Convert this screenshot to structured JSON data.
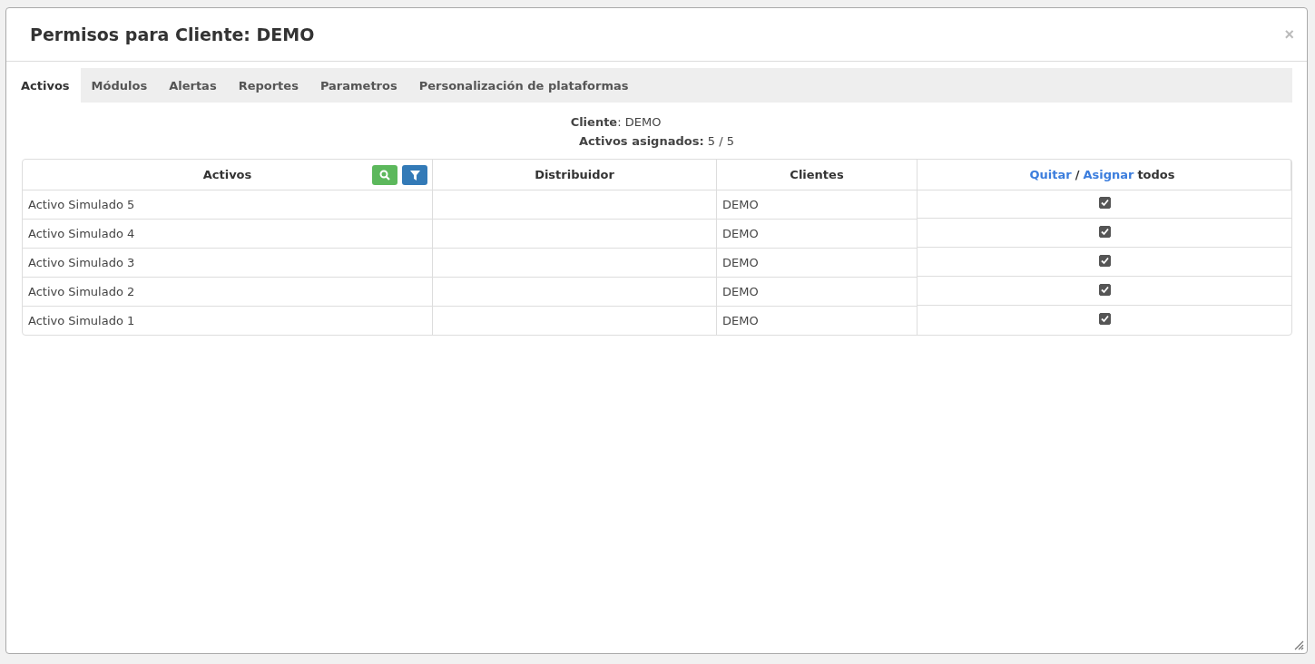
{
  "dialog": {
    "title": "Permisos para Cliente: DEMO",
    "close": "×"
  },
  "tabs": [
    {
      "label": "Activos",
      "selected": true
    },
    {
      "label": "Módulos",
      "selected": false
    },
    {
      "label": "Alertas",
      "selected": false
    },
    {
      "label": "Reportes",
      "selected": false
    },
    {
      "label": "Parametros",
      "selected": false
    },
    {
      "label": "Personalización de plataformas",
      "selected": false
    }
  ],
  "info": [
    "**Cliente**: DEMO",
    "**Activos asignados:** 5 / 5"
  ],
  "table": {
    "columns": [
      "Activos",
      "Distribuidor",
      "Clientes"
    ],
    "select_all": {
      "remove_link": "Quitar",
      "separator": "/",
      "assign_link": "Asignar",
      "suffix": "todos"
    },
    "rows": [
      {
        "asset": "Activo Simulado 5",
        "client": "DEMO",
        "checked": true
      },
      {
        "asset": "Activo Simulado 4",
        "client": "DEMO",
        "checked": true
      },
      {
        "asset": "Activo Simulado 3",
        "client": "DEMO",
        "checked": true
      },
      {
        "asset": "Activo Simulado 2",
        "client": "DEMO",
        "checked": true
      },
      {
        "asset": "Activo Simulado 1",
        "client": "DEMO",
        "checked": true
      }
    ]
  }
}
